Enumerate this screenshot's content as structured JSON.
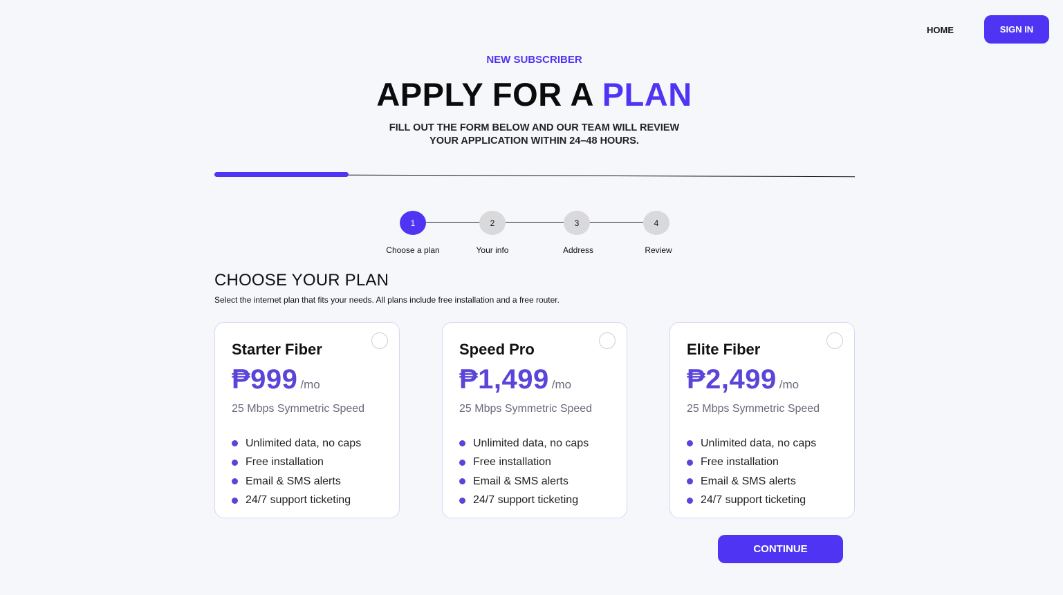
{
  "nav": {
    "home_label": "HOME",
    "signin_label": "SIGN IN"
  },
  "header": {
    "eyebrow": "NEW SUBSCRIBER",
    "title_main": "APPLY FOR A ",
    "title_accent": "PLAN",
    "subtitle_line1": "FILL OUT THE FORM BELOW AND OUR TEAM WILL REVIEW",
    "subtitle_line2": "YOUR APPLICATION WITHIN 24–48 HOURS."
  },
  "progress": {
    "fraction": 0.21
  },
  "stepper": {
    "current": 1,
    "steps": [
      {
        "number": "1",
        "label": "Choose a plan"
      },
      {
        "number": "2",
        "label": "Your info"
      },
      {
        "number": "3",
        "label": "Address"
      },
      {
        "number": "4",
        "label": "Review"
      }
    ]
  },
  "section": {
    "title": "CHOOSE YOUR PLAN",
    "description": "Select the internet plan that fits your needs. All plans include free installation and a free router."
  },
  "plans": [
    {
      "name": "Starter Fiber",
      "price": "₱999",
      "period": "/mo",
      "speed": "25 Mbps Symmetric Speed",
      "features": [
        "Unlimited data, no caps",
        "Free installation",
        "Email & SMS alerts",
        "24/7 support ticketing"
      ]
    },
    {
      "name": "Speed Pro",
      "price": "₱1,499",
      "period": "/mo",
      "speed": "25 Mbps Symmetric Speed",
      "features": [
        "Unlimited data, no caps",
        "Free installation",
        "Email & SMS alerts",
        "24/7 support ticketing"
      ]
    },
    {
      "name": "Elite Fiber",
      "price": "₱2,499",
      "period": "/mo",
      "speed": "25 Mbps Symmetric Speed",
      "features": [
        "Unlimited data, no caps",
        "Free installation",
        "Email & SMS alerts",
        "24/7 support ticketing"
      ]
    }
  ],
  "actions": {
    "continue_label": "CONTINUE"
  },
  "colors": {
    "accent": "#4f35f3",
    "price": "#5a45d8",
    "background": "#f6f7fb"
  }
}
